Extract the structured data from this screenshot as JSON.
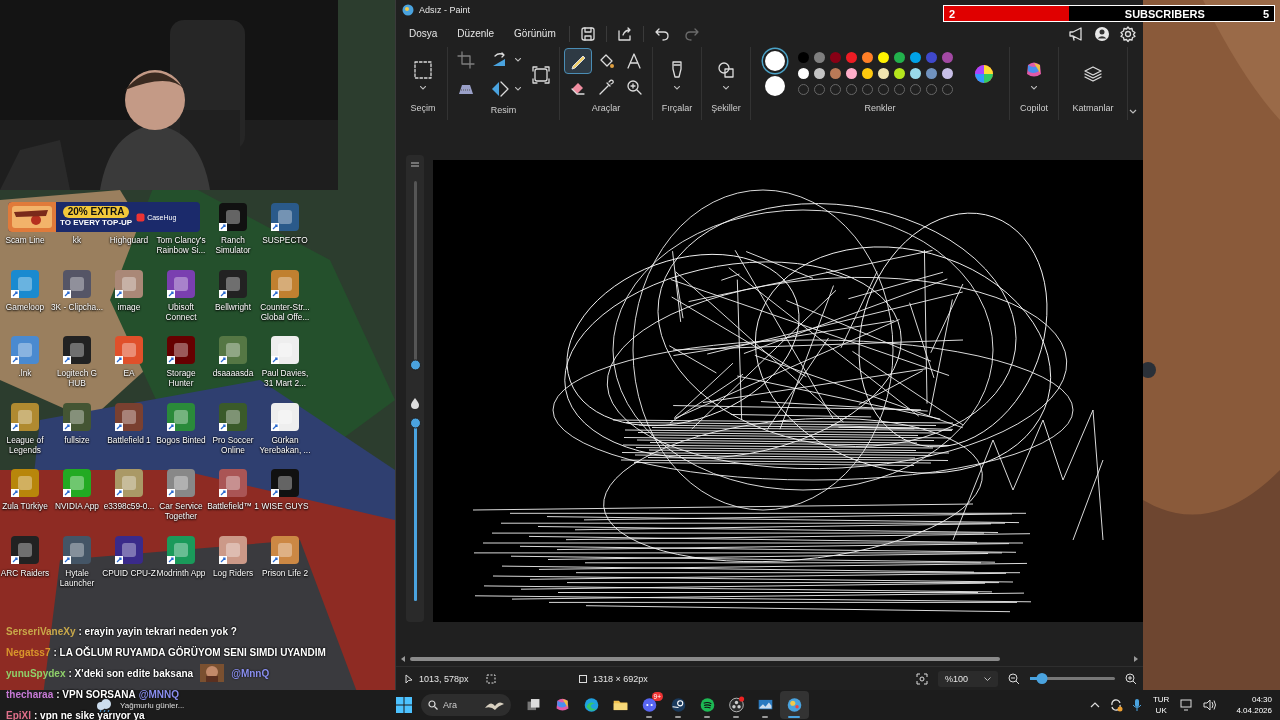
{
  "ad_banner": {
    "headline": "20% EXTRA",
    "subline": "TO EVERY TOP-UP",
    "brand": "CaseHug"
  },
  "labels_under_banner": [
    "Scam Line",
    "kk",
    "Highguard",
    "Tom Clancy's Rainbow Si..."
  ],
  "desktop_icons": [
    {
      "label": "Ranch Simulator"
    },
    {
      "label": "SUSPECTO"
    },
    {
      "label": "Gameloop"
    },
    {
      "label": "3K - Clipcha..."
    },
    {
      "label": "image"
    },
    {
      "label": "Ubisoft Connect"
    },
    {
      "label": "Bellwright"
    },
    {
      "label": "Counter-Str... Global Offe..."
    },
    {
      "label": ".lnk"
    },
    {
      "label": "Logitech G HUB"
    },
    {
      "label": "EA"
    },
    {
      "label": "Storage Hunter"
    },
    {
      "label": "dsaaaasda"
    },
    {
      "label": "Paul Davies, 31 Mart 2..."
    },
    {
      "label": "League of Legends"
    },
    {
      "label": "fullsize"
    },
    {
      "label": "Battlefield 1"
    },
    {
      "label": "Bogos Binted"
    },
    {
      "label": "Pro Soccer Online"
    },
    {
      "label": "Gürkan Yerebakan, ..."
    },
    {
      "label": "Zula Türkiye"
    },
    {
      "label": "NVIDIA App"
    },
    {
      "label": "e3398c59-0..."
    },
    {
      "label": "Car Service Together"
    },
    {
      "label": "Battlefield™ 1"
    },
    {
      "label": "WISE GUYS"
    },
    {
      "label": "ARC Raiders"
    },
    {
      "label": "Hytale Launcher"
    },
    {
      "label": "CPUID CPU-Z"
    },
    {
      "label": "Modrinth App"
    },
    {
      "label": "Log Riders"
    },
    {
      "label": "Prison Life 2"
    }
  ],
  "subscriber_goal": {
    "current": "2",
    "label": "SUBSCRIBERS",
    "target": "5",
    "level": 0.38
  },
  "paint": {
    "title": "Adsız - Paint",
    "menu": [
      "Dosya",
      "Düzenle",
      "Görünüm"
    ],
    "quick_actions": [
      {
        "kind": "save",
        "disabled": false
      },
      {
        "kind": "share",
        "disabled": false
      },
      {
        "kind": "undo",
        "disabled": false
      },
      {
        "kind": "redo",
        "disabled": true
      }
    ],
    "header_icons": [
      {
        "kind": "announce"
      },
      {
        "kind": "account"
      },
      {
        "kind": "settings"
      }
    ],
    "ribbon": [
      {
        "label": "Seçim",
        "tools": [
          {
            "kind": "select"
          }
        ]
      },
      {
        "label": "Resim",
        "tools": [
          {
            "kind": "crop"
          },
          {
            "kind": "rotate"
          },
          {
            "kind": "resize"
          },
          {
            "kind": "background"
          },
          {
            "kind": "flip"
          }
        ]
      },
      {
        "label": "Araçlar",
        "tools": [
          {
            "kind": "pencil",
            "selected": true
          },
          {
            "kind": "fill",
            "selected": false
          },
          {
            "kind": "text",
            "selected": false
          },
          {
            "kind": "eraser",
            "selected": false
          },
          {
            "kind": "picker",
            "selected": false
          },
          {
            "kind": "magnifier",
            "selected": false
          }
        ]
      },
      {
        "label": "Fırçalar",
        "tools": [
          {
            "kind": "brush"
          }
        ]
      },
      {
        "label": "Şekiller",
        "tools": [
          {
            "kind": "shapes"
          }
        ]
      },
      {
        "label": "Renkler",
        "tools": [
          {
            "kind": "colors"
          }
        ]
      },
      {
        "label": "Copilot",
        "tools": [
          {
            "kind": "copilot"
          }
        ]
      },
      {
        "label": "Katmanlar",
        "tools": [
          {
            "kind": "layers"
          }
        ]
      }
    ],
    "active_colors": [
      {
        "color": "#ffffff",
        "selected": true
      },
      {
        "color": "#ffffff",
        "selected": false
      }
    ],
    "palette": [
      {
        "kind": "swatch",
        "color": "#000000"
      },
      {
        "kind": "swatch",
        "color": "#7f7f7f"
      },
      {
        "kind": "swatch",
        "color": "#880015"
      },
      {
        "kind": "swatch",
        "color": "#ed1c24"
      },
      {
        "kind": "swatch",
        "color": "#ff7f27"
      },
      {
        "kind": "swatch",
        "color": "#fff200"
      },
      {
        "kind": "swatch",
        "color": "#22b14c"
      },
      {
        "kind": "swatch",
        "color": "#00a2e8"
      },
      {
        "kind": "swatch",
        "color": "#3f48cc"
      },
      {
        "kind": "swatch",
        "color": "#a349a4"
      },
      {
        "kind": "swatch",
        "color": "#ffffff"
      },
      {
        "kind": "swatch",
        "color": "#c3c3c3"
      },
      {
        "kind": "swatch",
        "color": "#b97a57"
      },
      {
        "kind": "swatch",
        "color": "#ffaec9"
      },
      {
        "kind": "swatch",
        "color": "#ffc90e"
      },
      {
        "kind": "swatch",
        "color": "#efe4b0"
      },
      {
        "kind": "swatch",
        "color": "#b5e61d"
      },
      {
        "kind": "swatch",
        "color": "#99d9ea"
      },
      {
        "kind": "swatch",
        "color": "#7092be"
      },
      {
        "kind": "swatch",
        "color": "#c8bfe7"
      },
      {
        "kind": "empty"
      },
      {
        "kind": "empty"
      },
      {
        "kind": "empty"
      },
      {
        "kind": "empty"
      },
      {
        "kind": "empty"
      },
      {
        "kind": "empty"
      },
      {
        "kind": "empty"
      },
      {
        "kind": "empty"
      },
      {
        "kind": "empty"
      },
      {
        "kind": "empty"
      }
    ],
    "size_slider": {
      "level": 0.02
    },
    "opacity_slider": {
      "level": 1
    },
    "status": {
      "cursor": "1013, 578px",
      "canvas_size": "1318 × 692px",
      "zoom": "%100",
      "zoom_slider": {
        "level": 0.14
      }
    }
  },
  "chat": [
    {
      "user": "SerseriVaneXy",
      "color": "#c9a94a",
      "text": ": erayin yayin tekrari neden yok ?"
    },
    {
      "user": "Negatss7",
      "color": "#d9962b",
      "text": ": LA OĞLUM RUYAMDA GÖRÜYOM SENI SIMDI UYANDIM"
    },
    {
      "user": "yunuSpydex",
      "color": "#8fd16a",
      "text": ": X'deki son edite baksana",
      "emote": true,
      "mention": "@MnnQ"
    },
    {
      "user": "thecharaa",
      "color": "#c77ad6",
      "text": ": VPN SORSANA",
      "mention": "@MNNQ"
    },
    {
      "user": "EpiXl",
      "color": "#e0708a",
      "text": ": vpn ne sike yarıyor ya"
    }
  ],
  "taskbar": {
    "weather": "Yağmurlu günler...",
    "search_placeholder": "Ara",
    "apps": [
      {
        "kind": "taskview",
        "running": false,
        "active": false
      },
      {
        "kind": "copilot",
        "running": false,
        "active": false
      },
      {
        "kind": "edge",
        "running": false,
        "active": false
      },
      {
        "kind": "folder",
        "running": false,
        "active": false
      },
      {
        "kind": "discord",
        "running": true,
        "active": false,
        "badge": "9+"
      },
      {
        "kind": "steam",
        "running": true,
        "active": false
      },
      {
        "kind": "spotify",
        "running": true,
        "active": false
      },
      {
        "kind": "obs",
        "running": true,
        "active": false
      },
      {
        "kind": "monitor",
        "running": true,
        "active": false
      },
      {
        "kind": "paint",
        "running": true,
        "active": true
      }
    ],
    "language": "TUR",
    "layout": "UK",
    "time": "04:30",
    "date": "4.04.2026"
  }
}
